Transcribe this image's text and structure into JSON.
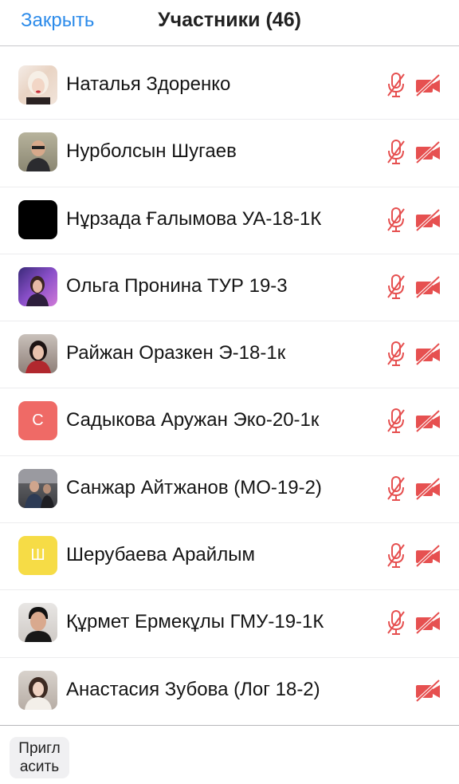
{
  "header": {
    "close_label": "Закрыть",
    "title": "Участники (46)"
  },
  "participants": [
    {
      "name": "Наталья Здоренко",
      "avatar": "photo",
      "avatar_letter": "",
      "mic_muted": true,
      "video_off": true
    },
    {
      "name": "Нурболсын Шугаев",
      "avatar": "photo",
      "avatar_letter": "",
      "mic_muted": true,
      "video_off": true
    },
    {
      "name": "Нұрзада Ғалымова УА-18-1К",
      "avatar": "photo",
      "avatar_letter": "",
      "mic_muted": true,
      "video_off": true
    },
    {
      "name": "Ольга Пронина ТУР 19-3",
      "avatar": "photo",
      "avatar_letter": "",
      "mic_muted": true,
      "video_off": true
    },
    {
      "name": "Райжан Оразкен Э-18-1к",
      "avatar": "photo",
      "avatar_letter": "",
      "mic_muted": true,
      "video_off": true
    },
    {
      "name": "Садыкова Аружан Эко-20-1к",
      "avatar": "letter",
      "avatar_letter": "С",
      "mic_muted": true,
      "video_off": true
    },
    {
      "name": "Санжар Айтжанов (МО-19-2)",
      "avatar": "photo",
      "avatar_letter": "",
      "mic_muted": true,
      "video_off": true
    },
    {
      "name": "Шерубаева Арайлым",
      "avatar": "letter",
      "avatar_letter": "Ш",
      "mic_muted": true,
      "video_off": true
    },
    {
      "name": "Құрмет Ермекұлы ГМУ-19-1К",
      "avatar": "photo",
      "avatar_letter": "",
      "mic_muted": true,
      "video_off": true
    },
    {
      "name": "Анастасия Зубова (Лог 18-2)",
      "avatar": "photo",
      "avatar_letter": "",
      "mic_muted": false,
      "video_off": true
    }
  ],
  "footer": {
    "invite_label_line1": "Пригл",
    "invite_label_line2": "асить"
  },
  "colors": {
    "accent": "#2c8bea",
    "muted_icon": "#e65050",
    "avatar_letter_s": "#ef6a66",
    "avatar_letter_sh": "#f6dc46"
  }
}
